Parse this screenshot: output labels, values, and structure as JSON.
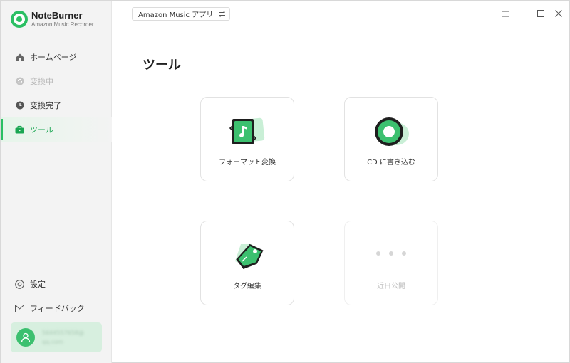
{
  "app": {
    "name": "NoteBurner",
    "subtitle": "Amazon Music Recorder"
  },
  "sidebar": {
    "items": [
      {
        "label": "ホームページ",
        "icon": "home-icon",
        "state": "normal"
      },
      {
        "label": "変換中",
        "icon": "sync-icon",
        "state": "disabled"
      },
      {
        "label": "変換完了",
        "icon": "clock-icon",
        "state": "normal"
      },
      {
        "label": "ツール",
        "icon": "toolbox-icon",
        "state": "active"
      }
    ],
    "bottom": [
      {
        "label": "設定",
        "icon": "gear-icon"
      },
      {
        "label": "フィードバック",
        "icon": "mail-icon"
      }
    ],
    "user": {
      "line1": "5644557658@",
      "line2": "qq.com"
    }
  },
  "topbar": {
    "source_label": "Amazon Music アプリ"
  },
  "main": {
    "title": "ツール",
    "tools": [
      {
        "label": "フォーマット変換",
        "icon": "format-convert-icon"
      },
      {
        "label": "CD に書き込む",
        "icon": "cd-burn-icon"
      },
      {
        "label": "タグ編集",
        "icon": "tag-edit-icon"
      },
      {
        "label": "近日公開",
        "icon": "more-dots-icon"
      }
    ]
  },
  "colors": {
    "accent": "#2bbf63",
    "active_text": "#1aa652",
    "sidebar_bg": "#f3f3f3"
  }
}
